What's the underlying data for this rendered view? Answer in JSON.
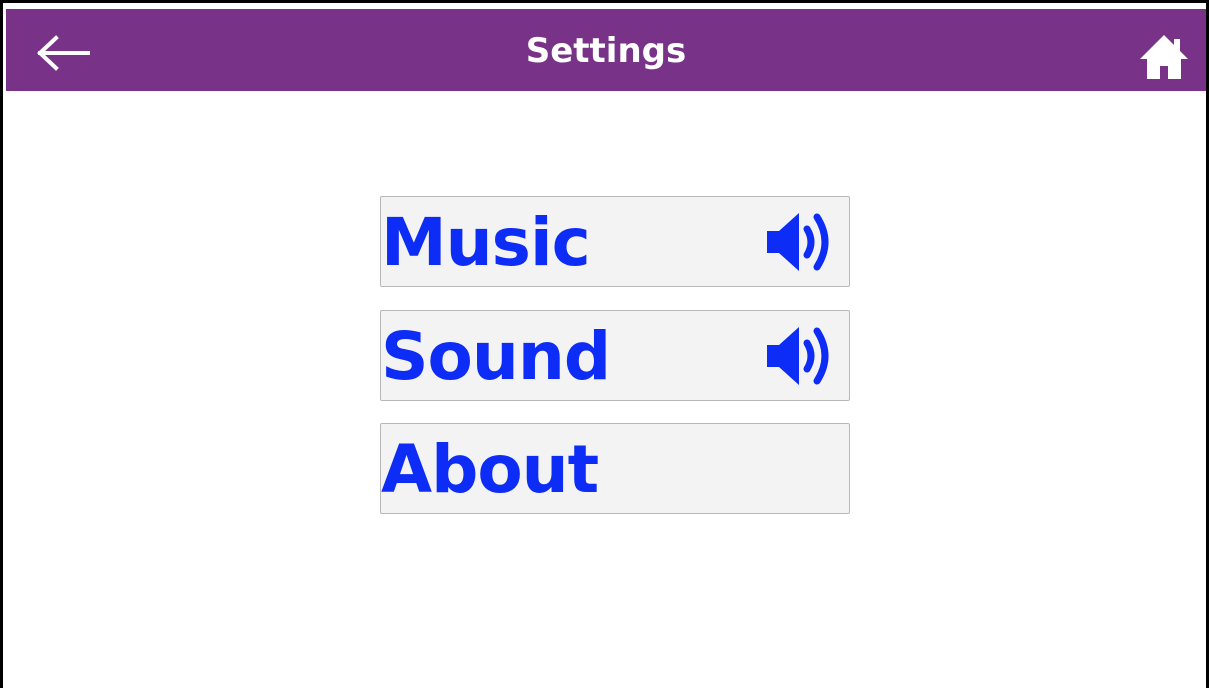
{
  "header": {
    "title": "Settings",
    "back_icon": "left-arrow-icon",
    "home_icon": "home-icon",
    "background_color": "#783389"
  },
  "menu": {
    "items": [
      {
        "label": "Music",
        "icon": "speaker-icon"
      },
      {
        "label": "Sound",
        "icon": "speaker-icon"
      },
      {
        "label": "About"
      }
    ],
    "text_color": "#0d2cf5",
    "button_background": "#f3f3f3"
  }
}
